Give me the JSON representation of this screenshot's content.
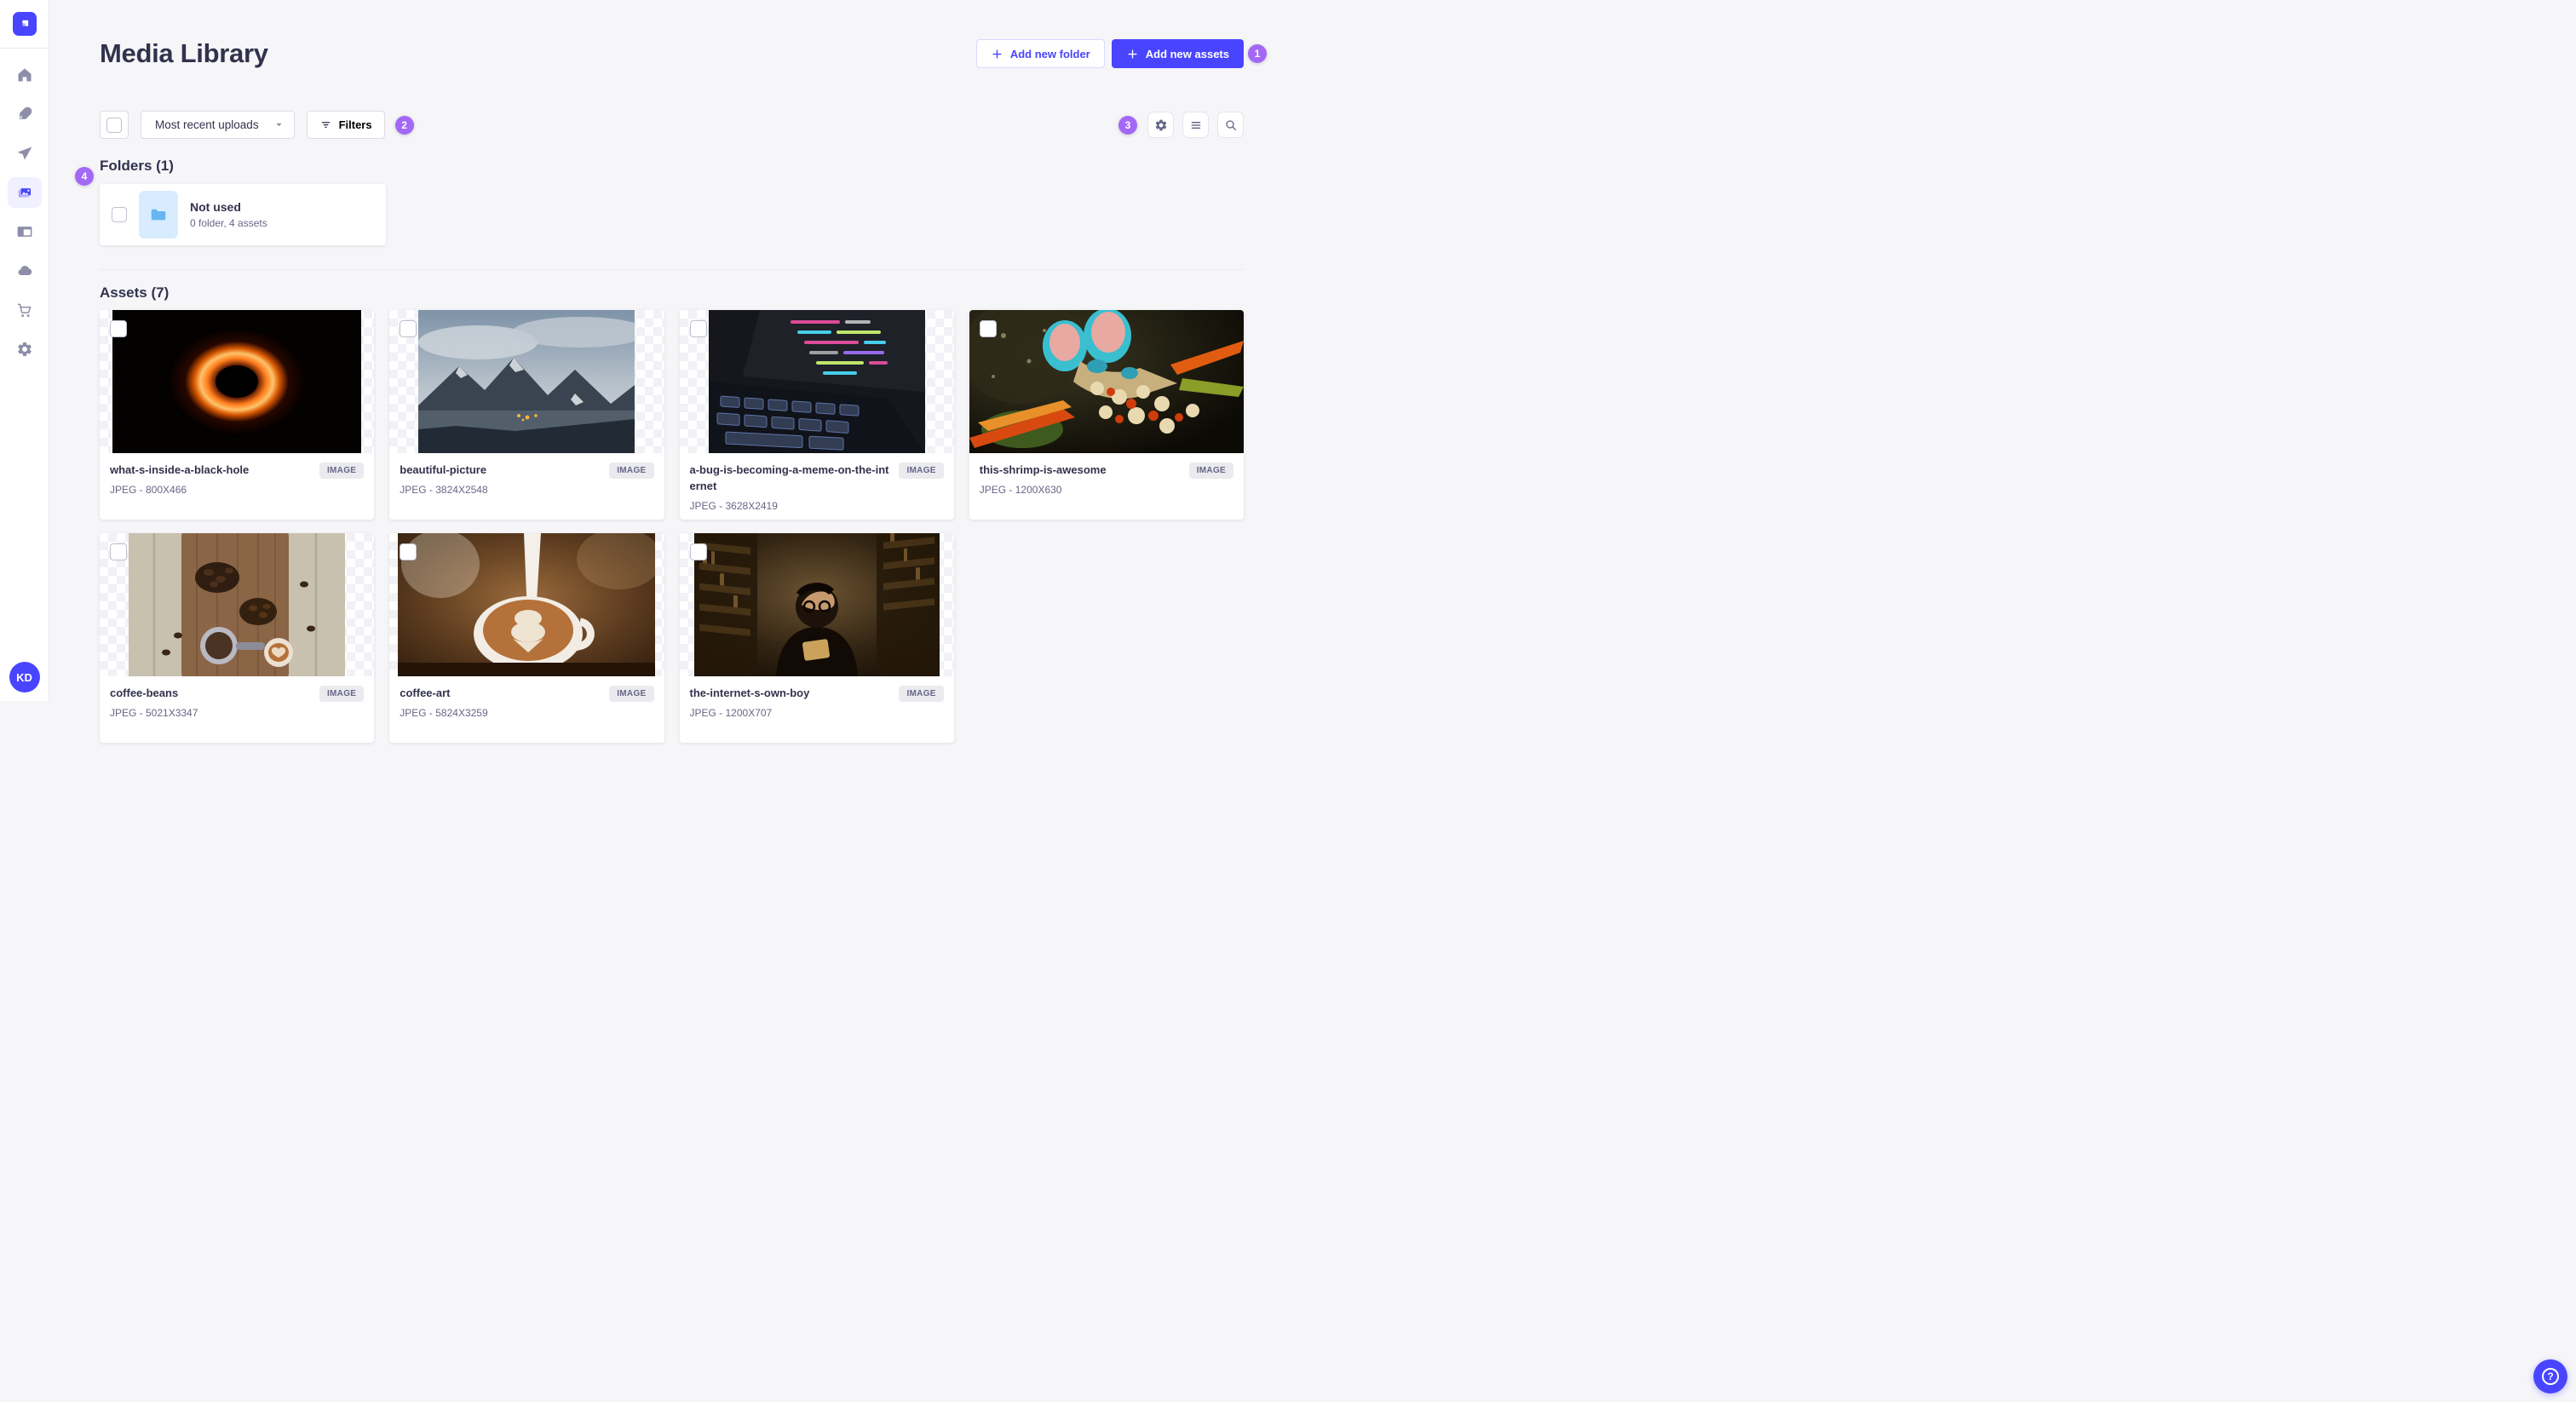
{
  "app": {
    "title": "Media Library"
  },
  "colors": {
    "primary": "#4945FF",
    "step_badge": "#A368F5",
    "text_dark": "#32324D",
    "text_muted": "#666687",
    "active_pill": "#F0F0FF"
  },
  "sidebar": {
    "logo_icon": "strapi-logo",
    "items": [
      {
        "label": "Home",
        "icon": "home-icon"
      },
      {
        "label": "Content",
        "icon": "feather-icon"
      },
      {
        "label": "Deploy",
        "icon": "paper-plane-icon"
      },
      {
        "label": "Media Library",
        "icon": "images-icon",
        "active": true
      },
      {
        "label": "Content-type Builder",
        "icon": "layout-icon"
      },
      {
        "label": "Cloud",
        "icon": "cloud-icon"
      },
      {
        "label": "Marketplace",
        "icon": "cart-icon"
      },
      {
        "label": "Settings",
        "icon": "gear-icon"
      }
    ],
    "avatar_initials": "KD"
  },
  "header": {
    "title": "Media Library",
    "add_folder_label": "Add new folder",
    "add_assets_label": "Add new assets",
    "step_badge": "1"
  },
  "toolbar": {
    "sort_value": "Most recent uploads",
    "filters_label": "Filters",
    "filters_step_badge": "2",
    "view_step_badge": "3",
    "icon_buttons": [
      "gear-icon",
      "list-icon",
      "search-icon"
    ]
  },
  "folders": {
    "heading": "Folders (1)",
    "step_badge": "4",
    "items": [
      {
        "name": "Not used",
        "meta": "0 folder, 4 assets"
      }
    ]
  },
  "assets": {
    "heading": "Assets (7)",
    "items": [
      {
        "title": "what-s-inside-a-black-hole",
        "meta": "JPEG - 800X466",
        "badge": "IMAGE",
        "thumb": "black-hole"
      },
      {
        "title": "beautiful-picture",
        "meta": "JPEG - 3824X2548",
        "badge": "IMAGE",
        "thumb": "mountains"
      },
      {
        "title": "a-bug-is-becoming-a-meme-on-the-internet",
        "meta": "JPEG - 3628X2419",
        "badge": "IMAGE",
        "thumb": "laptop-code"
      },
      {
        "title": "this-shrimp-is-awesome",
        "meta": "JPEG - 1200X630",
        "badge": "IMAGE",
        "thumb": "mantis-shrimp"
      },
      {
        "title": "coffee-beans",
        "meta": "JPEG - 5021X3347",
        "badge": "IMAGE",
        "thumb": "coffee-beans"
      },
      {
        "title": "coffee-art",
        "meta": "JPEG - 5824X3259",
        "badge": "IMAGE",
        "thumb": "latte-art"
      },
      {
        "title": "the-internet-s-own-boy",
        "meta": "JPEG - 1200X707",
        "badge": "IMAGE",
        "thumb": "library-portrait"
      }
    ]
  },
  "help": {
    "label": "?"
  }
}
